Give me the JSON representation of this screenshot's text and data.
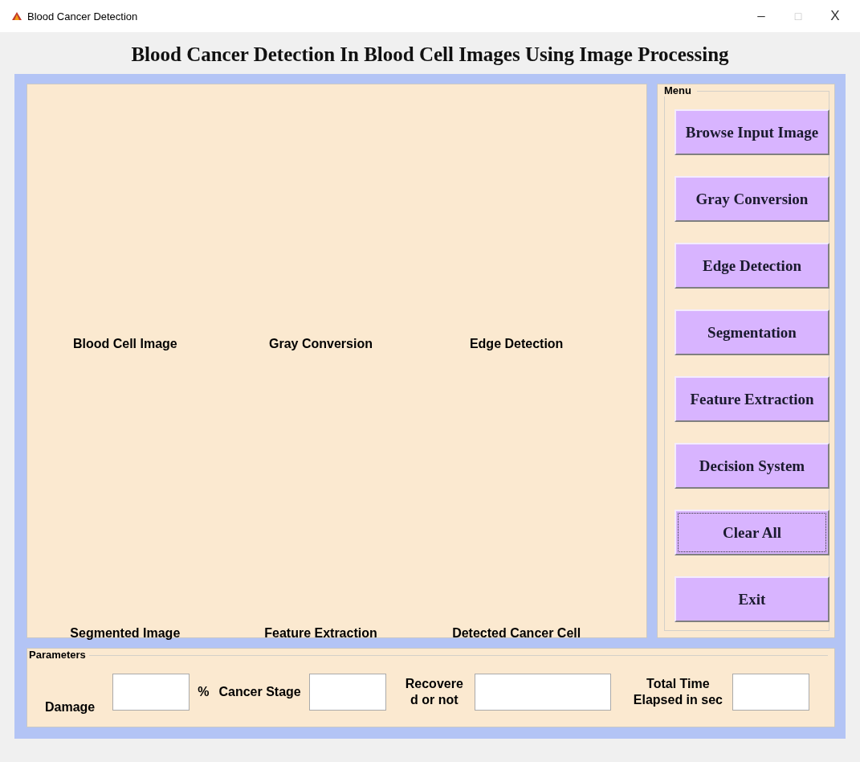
{
  "window": {
    "title": "Blood Cancer Detection",
    "controls": [
      "–",
      "□",
      "X"
    ]
  },
  "heading": "Blood Cancer Detection In Blood Cell Images Using Image Processing",
  "axes": [
    {
      "label": "Blood Cell Image"
    },
    {
      "label": "Gray Conversion"
    },
    {
      "label": "Edge Detection"
    },
    {
      "label": "Segmented Image"
    },
    {
      "label": "Feature Extraction"
    },
    {
      "label": "Detected Cancer Cell"
    }
  ],
  "menu": {
    "title": "Menu",
    "buttons": [
      {
        "label": "Browse Input Image",
        "focused": false
      },
      {
        "label": "Gray Conversion",
        "focused": false
      },
      {
        "label": "Edge Detection",
        "focused": false
      },
      {
        "label": "Segmentation",
        "focused": false
      },
      {
        "label": "Feature Extraction",
        "focused": false
      },
      {
        "label": "Decision System",
        "focused": false
      },
      {
        "label": "Clear All",
        "focused": true
      },
      {
        "label": "Exit",
        "focused": false
      }
    ]
  },
  "parameters": {
    "title": "Parameters",
    "fields": [
      {
        "label": "Damage",
        "unit": "%"
      },
      {
        "label": "Cancer Stage"
      },
      {
        "label": "Recovere\nd or not",
        "wide": true
      },
      {
        "label": "Total Time\nElapsed in sec"
      }
    ]
  }
}
